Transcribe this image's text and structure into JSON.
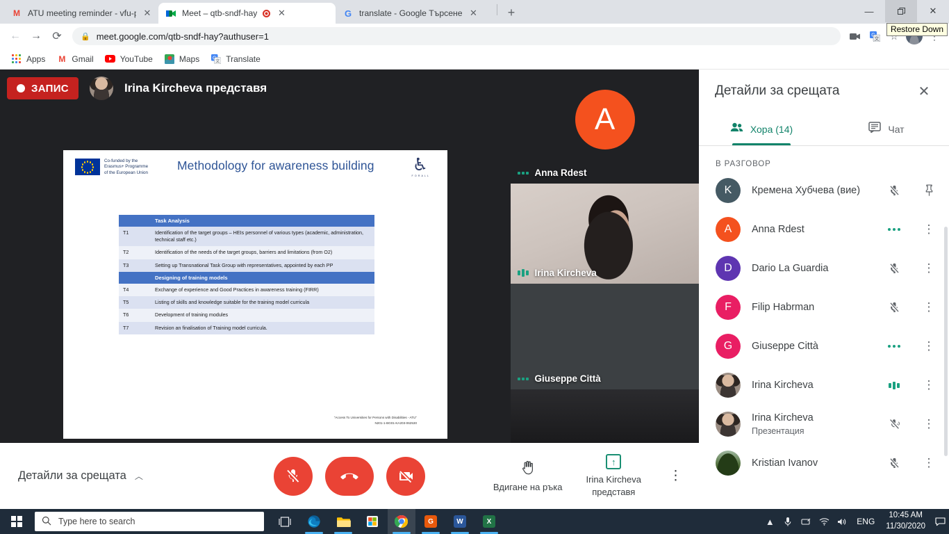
{
  "browser": {
    "tabs": [
      {
        "title": "ATU meeting reminder - vfu-proj",
        "favicon": "gmail-icon",
        "active": false,
        "recording": false
      },
      {
        "title": "Meet – qtb-sndf-hay",
        "favicon": "meet-icon",
        "active": true,
        "recording": true
      },
      {
        "title": "translate - Google Търсене",
        "favicon": "google-icon",
        "active": false,
        "recording": false
      }
    ],
    "new_tab_label": "+",
    "close_label": "✕",
    "url": "meet.google.com/qtb-sndf-hay?authuser=1",
    "nav": {
      "back": "←",
      "forward": "→",
      "reload": "⟳"
    },
    "window": {
      "minimize": "—",
      "restore": "❐",
      "close": "✕",
      "tooltip": "Restore Down"
    },
    "toolbar_icons": [
      "camera-icon",
      "translate-icon",
      "bookmark-star-icon",
      "profile-avatar",
      "chrome-menu-icon"
    ],
    "bookmarks": [
      {
        "label": "Apps",
        "icon": "apps-grid-icon"
      },
      {
        "label": "Gmail",
        "icon": "gmail-icon"
      },
      {
        "label": "YouTube",
        "icon": "youtube-icon"
      },
      {
        "label": "Maps",
        "icon": "maps-icon"
      },
      {
        "label": "Translate",
        "icon": "translate-icon"
      }
    ]
  },
  "meet": {
    "recording_badge": "ЗАПИС",
    "presenter_banner": "Irina Kircheva представя",
    "slide": {
      "title": "Methodology for awareness building",
      "eu_logo_text": "Co-funded by the\nErasmus+ Programme\nof the European Union",
      "eu_line1": "Co-funded by the",
      "eu_line2": "Erasmus+ Programme",
      "eu_line3": "of the European Union",
      "atu_logo_caption": "F O R   A L L",
      "table": {
        "section1_header": "Task Analysis",
        "section2_header": "Designing of training models",
        "rows_section1": [
          {
            "id": "T1",
            "text": "Identification of the target groups – HEIs personnel of various types (academic, administration, technical staff etc.)"
          },
          {
            "id": "T2",
            "text": "Identification of the needs of the target groups, barriers and limitations (from O2)"
          },
          {
            "id": "T3",
            "text": "Setting up Transnational Task Group with representatives, appointed by each PP"
          }
        ],
        "rows_section2": [
          {
            "id": "T4",
            "text": "Exchange of experience and Good Practices in awareness training (FIRR)"
          },
          {
            "id": "T5",
            "text": "Listing of skills and knowledge suitable for the training model curricula"
          },
          {
            "id": "T6",
            "text": "Development of training modules"
          },
          {
            "id": "T7",
            "text": "Revision an finalisation of Training model curricula."
          }
        ]
      },
      "footer_line1": "\"Access To Universities for Persons with Disabilities - ATU\"",
      "footer_line2": "N201-1-BG01-KA203-062530"
    },
    "tiles": [
      {
        "name": "Anna Rdest",
        "kind": "initial",
        "initial": "A",
        "speaking": false
      },
      {
        "name": "Irina Kircheva",
        "kind": "video",
        "speaking": true
      },
      {
        "name": "Giuseppe Città",
        "kind": "video",
        "speaking": false
      }
    ],
    "controls": {
      "details_label": "Детали за срещата",
      "details_label_real": "Детайли за срещата",
      "mic_button": "mic-off-icon",
      "hangup_button": "end-call-icon",
      "camera_button": "camera-off-icon",
      "raise_hand_label": "Вдигане на ръка",
      "present_label_line1": "Irina Kircheva",
      "present_label_line2": "представя",
      "more_options": "more-options-icon"
    }
  },
  "panel": {
    "title": "Детайли за срещата",
    "close_icon": "close-icon",
    "tabs": [
      {
        "label": "Хора (14)",
        "icon": "people-icon",
        "active": true
      },
      {
        "label": "Чат",
        "icon": "chat-icon",
        "active": false
      }
    ],
    "section_label": "В РАЗГОВОР",
    "participants": [
      {
        "name": "Кремена Хубчева (вие)",
        "sub": "",
        "avatar_type": "letter",
        "letter": "K",
        "color": "#455a64",
        "status": "muted",
        "action": "pin-icon"
      },
      {
        "name": "Anna Rdest",
        "sub": "",
        "avatar_type": "letter",
        "letter": "A",
        "color": "#f4511e",
        "status": "speaking-dots",
        "action": "more-icon"
      },
      {
        "name": "Dario La Guardia",
        "sub": "",
        "avatar_type": "letter",
        "letter": "D",
        "color": "#5e35b1",
        "status": "muted",
        "action": "more-icon"
      },
      {
        "name": "Filip Habrman",
        "sub": "",
        "avatar_type": "letter",
        "letter": "F",
        "color": "#e91e63",
        "status": "muted",
        "action": "more-icon"
      },
      {
        "name": "Giuseppe Città",
        "sub": "",
        "avatar_type": "letter",
        "letter": "G",
        "color": "#e91e63",
        "status": "speaking-dots",
        "action": "more-icon"
      },
      {
        "name": "Irina Kircheva",
        "sub": "",
        "avatar_type": "photo-irina",
        "letter": "",
        "color": "#9b8d83",
        "status": "speaking-bars",
        "action": "more-icon"
      },
      {
        "name": "Irina Kircheva",
        "sub": "Презентация",
        "avatar_type": "photo-irina",
        "letter": "",
        "color": "#9b8d83",
        "status": "muted-speaker",
        "action": "more-icon"
      },
      {
        "name": "Kristian Ivanov",
        "sub": "",
        "avatar_type": "photo-kristian",
        "letter": "",
        "color": "#3f5a2e",
        "status": "muted",
        "action": "more-icon"
      }
    ]
  },
  "taskbar": {
    "search_placeholder": "Type here to search",
    "start_icon": "windows-start-icon",
    "apps": [
      {
        "name": "task-view-icon",
        "running": false
      },
      {
        "name": "edge-icon",
        "running": true
      },
      {
        "name": "file-explorer-icon",
        "running": true
      },
      {
        "name": "microsoft-store-icon",
        "running": false
      },
      {
        "name": "chrome-icon",
        "running": true
      },
      {
        "name": "pdf-app-icon",
        "running": true
      },
      {
        "name": "word-icon",
        "running": true
      },
      {
        "name": "excel-icon",
        "running": true
      }
    ],
    "tray": {
      "chevron": "▲",
      "icons": [
        "microphone-icon",
        "pen-tablet-icon",
        "wifi-icon",
        "volume-icon"
      ],
      "language": "ENG",
      "time": "10:45 AM",
      "date": "11/30/2020",
      "action_center": "notifications-icon"
    }
  },
  "colors": {
    "meet_green": "#12836a",
    "meet_red": "#ea4335",
    "record_red": "#c5221f",
    "slide_blue": "#4472c4",
    "slide_title_blue": "#2e5496",
    "taskbar_bg": "#1f2c3a"
  }
}
